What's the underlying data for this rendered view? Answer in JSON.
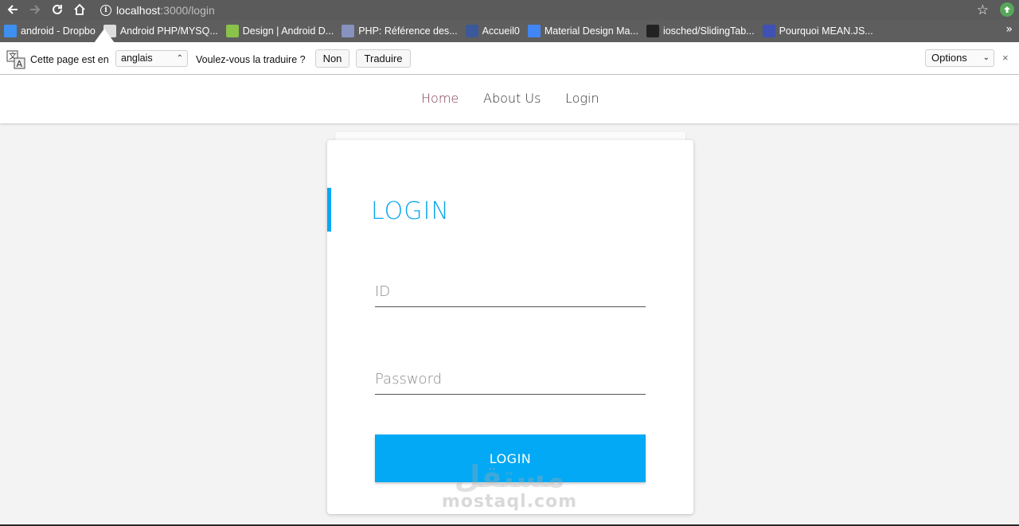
{
  "browser": {
    "url_host": "localhost",
    "url_path": ":3000/login",
    "bookmarks": [
      {
        "label": "android - Dropbo",
        "icon": "dropbox-icon",
        "color": "#3d8ff0"
      },
      {
        "label": "Android PHP/MYSQ...",
        "icon": "web-icon",
        "color": "#dddddd"
      },
      {
        "label": "Design | Android D...",
        "icon": "android-icon",
        "color": "#8ac24a"
      },
      {
        "label": "PHP: Référence des...",
        "icon": "php-icon",
        "color": "#8892bf"
      },
      {
        "label": "Accueil0",
        "icon": "facebook-icon",
        "color": "#3b5998"
      },
      {
        "label": "Material Design Ma...",
        "icon": "material-icon",
        "color": "#4285f4"
      },
      {
        "label": "iosched/SlidingTab...",
        "icon": "github-icon",
        "color": "#222222"
      },
      {
        "label": "Pourquoi MEAN.JS...",
        "icon": "meanjs-icon",
        "color": "#3f51b5"
      }
    ]
  },
  "translate": {
    "prefix": "Cette page est en",
    "language": "anglais",
    "question": "Voulez-vous la traduire ?",
    "no_label": "Non",
    "translate_label": "Traduire",
    "options_label": "Options",
    "close_symbol": "×"
  },
  "nav": {
    "items": [
      "Home",
      "About Us",
      "Login"
    ],
    "active": "Home",
    "active_color": "#7e3752"
  },
  "form": {
    "title": "LOGIN",
    "id_placeholder": "ID",
    "password_placeholder": "Password",
    "button_label": "LOGIN",
    "accent_color": "#03a9f4"
  },
  "watermark": {
    "arabic": "مستقل",
    "latin": "mostaql.com"
  }
}
